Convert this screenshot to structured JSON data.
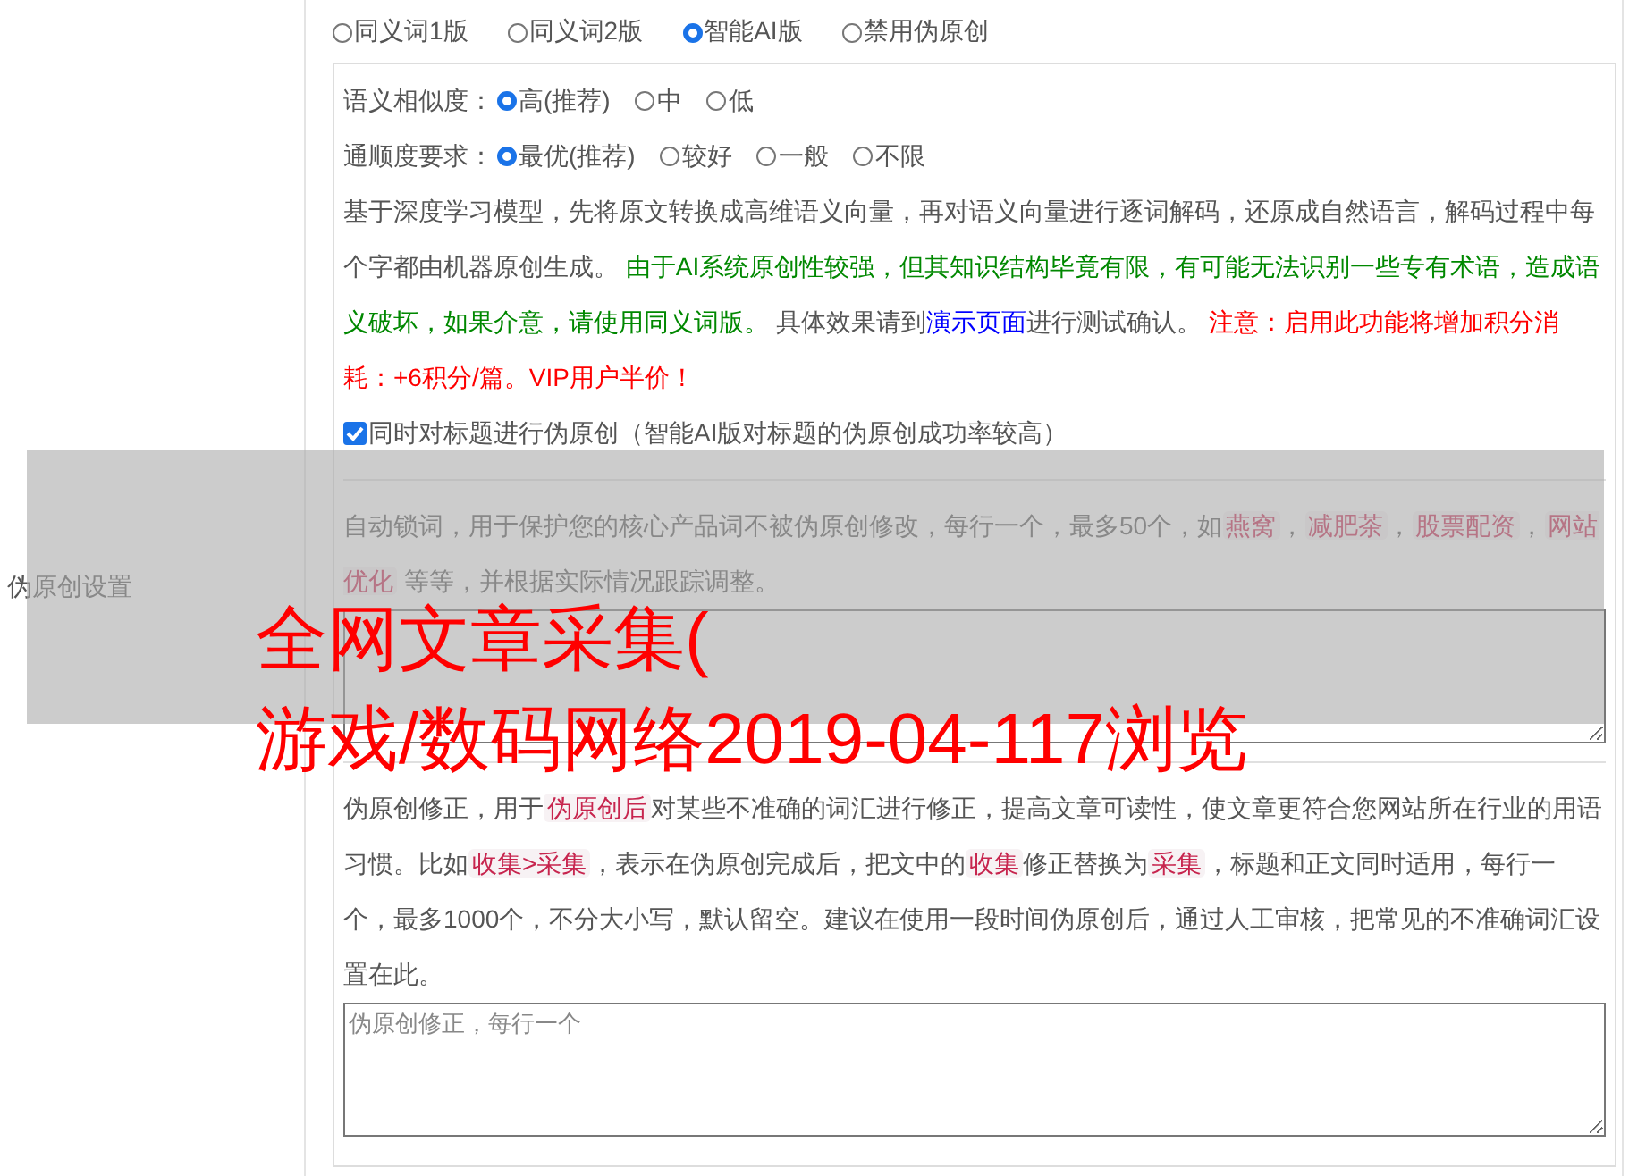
{
  "section_label": "伪原创设置",
  "modes": [
    {
      "label": "同义词1版",
      "selected": false
    },
    {
      "label": "同义词2版",
      "selected": false
    },
    {
      "label": "智能AI版",
      "selected": true
    },
    {
      "label": "禁用伪原创",
      "selected": false
    }
  ],
  "option_rows": [
    {
      "label": "语义相似度：",
      "options": [
        {
          "label": "高(推荐)",
          "selected": true
        },
        {
          "label": "中",
          "selected": false
        },
        {
          "label": "低",
          "selected": false
        }
      ]
    },
    {
      "label": "通顺度要求：",
      "options": [
        {
          "label": "最优(推荐)",
          "selected": true
        },
        {
          "label": "较好",
          "selected": false
        },
        {
          "label": "一般",
          "selected": false
        },
        {
          "label": "不限",
          "selected": false
        }
      ]
    }
  ],
  "description": [
    {
      "kind": "plain",
      "text": "基于深度学习模型，先将原文转换成高维语义向量，再对语义向量进行逐词解码，还原成自然语言，解码过程中每个字都由机器原创生成。 "
    },
    {
      "kind": "green",
      "text": "由于AI系统原创性较强，但其知识结构毕竟有限，有可能无法识别一些专有术语，造成语义破坏，如果介意，请使用同义词版。"
    },
    {
      "kind": "plain",
      "text": " 具体效果请到"
    },
    {
      "kind": "link",
      "text": "演示页面"
    },
    {
      "kind": "plain",
      "text": "进行测试确认。 "
    },
    {
      "kind": "red",
      "text": "注意：启用此功能将增加积分消耗：+6积分/篇。VIP用户半价！"
    }
  ],
  "title_option": {
    "label": "同时对标题进行伪原创（智能AI版对标题的伪原创成功率较高）",
    "checked": true
  },
  "lock_words": {
    "description": [
      {
        "kind": "plain",
        "text": "自动锁词，用于保护您的核心产品词不被伪原创修改，每行一个，最多50个，如"
      },
      {
        "kind": "code",
        "text": "燕窝"
      },
      {
        "kind": "plain",
        "text": "，"
      },
      {
        "kind": "code",
        "text": "减肥茶"
      },
      {
        "kind": "plain",
        "text": "，"
      },
      {
        "kind": "code",
        "text": "股票配资"
      },
      {
        "kind": "plain",
        "text": "，"
      },
      {
        "kind": "code",
        "text": "网站优化"
      },
      {
        "kind": "plain",
        "text": " 等等，并根据实际情况跟踪调整。"
      }
    ]
  },
  "corrections": {
    "description": [
      {
        "kind": "plain",
        "text": "伪原创修正，用于"
      },
      {
        "kind": "code",
        "text": "伪原创后"
      },
      {
        "kind": "plain",
        "text": "对某些不准确的词汇进行修正，提高文章可读性，使文章更符合您网站所在行业的用语习惯。比如"
      },
      {
        "kind": "code",
        "text": "收集>采集"
      },
      {
        "kind": "plain",
        "text": "，表示在伪原创完成后，把文中的"
      },
      {
        "kind": "code",
        "text": "收集"
      },
      {
        "kind": "plain",
        "text": "修正替换为"
      },
      {
        "kind": "code",
        "text": "采集"
      },
      {
        "kind": "plain",
        "text": "，标题和正文同时适用，每行一个，最多1000个，不分大小写，默认留空。建议在使用一段时间伪原创后，通过人工审核，把常见的不准确词汇设置在此。"
      }
    ],
    "placeholder": "伪原创修正，每行一个"
  },
  "overlay": {
    "title": "全网文章采集(",
    "subtitle": "游戏/数码网络2019-04-117浏览"
  }
}
